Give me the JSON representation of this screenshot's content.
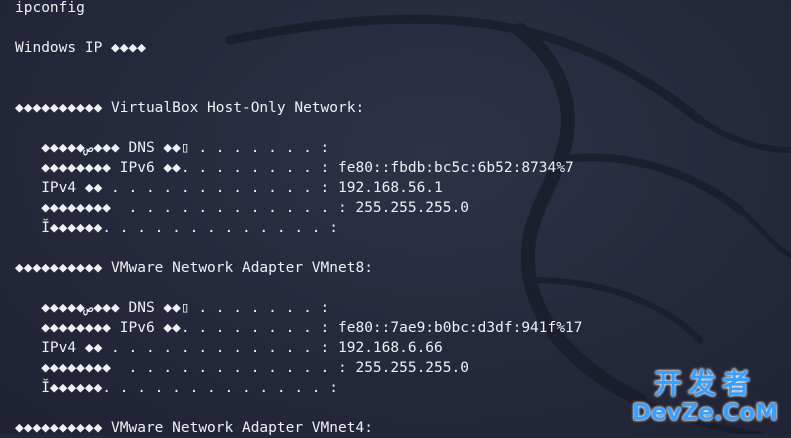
{
  "terminal": {
    "lines": [
      "ipconfig",
      "",
      "Windows IP ◆◆◆◆",
      "",
      "",
      "◆◆◆◆◆◆◆◆◆◆ VirtualBox Host-Only Network:",
      "",
      "   ◆◆◆◆◆ص◆◆◆ DNS ◆◆▯ . . . . . . . :",
      "   ◆◆◆◆◆◆◆◆ IPv6 ◆◆. . . . . . . . : fe80::fbdb:bc5c:6b52:8734%7",
      "   IPv4 ◆◆ . . . . . . . . . . . . : 192.168.56.1",
      "   ◆◆◆◆◆◆◆◆  . . . . . . . . . . . . : 255.255.255.0",
      "   Ĭ◆◆◆◆◆◆. . . . . . . . . . . . . :",
      "",
      "◆◆◆◆◆◆◆◆◆◆ VMware Network Adapter VMnet8:",
      "",
      "   ◆◆◆◆◆ص◆◆◆ DNS ◆◆▯ . . . . . . . :",
      "   ◆◆◆◆◆◆◆◆ IPv6 ◆◆. . . . . . . . : fe80::7ae9:b0bc:d3df:941f%17",
      "   IPv4 ◆◆ . . . . . . . . . . . . : 192.168.6.66",
      "   ◆◆◆◆◆◆◆◆  . . . . . . . . . . . . : 255.255.255.0",
      "   Ĭ◆◆◆◆◆◆. . . . . . . . . . . . . :",
      "",
      "◆◆◆◆◆◆◆◆◆◆ VMware Network Adapter VMnet4:"
    ]
  },
  "watermark": {
    "top": "开发者",
    "bottom": "DevZe.CoM"
  },
  "colors": {
    "background": "#23273a",
    "text": "#eef0f6",
    "watermark": "#3aa0ff"
  },
  "icons": {
    "background_art": "kali-dragon-icon"
  }
}
